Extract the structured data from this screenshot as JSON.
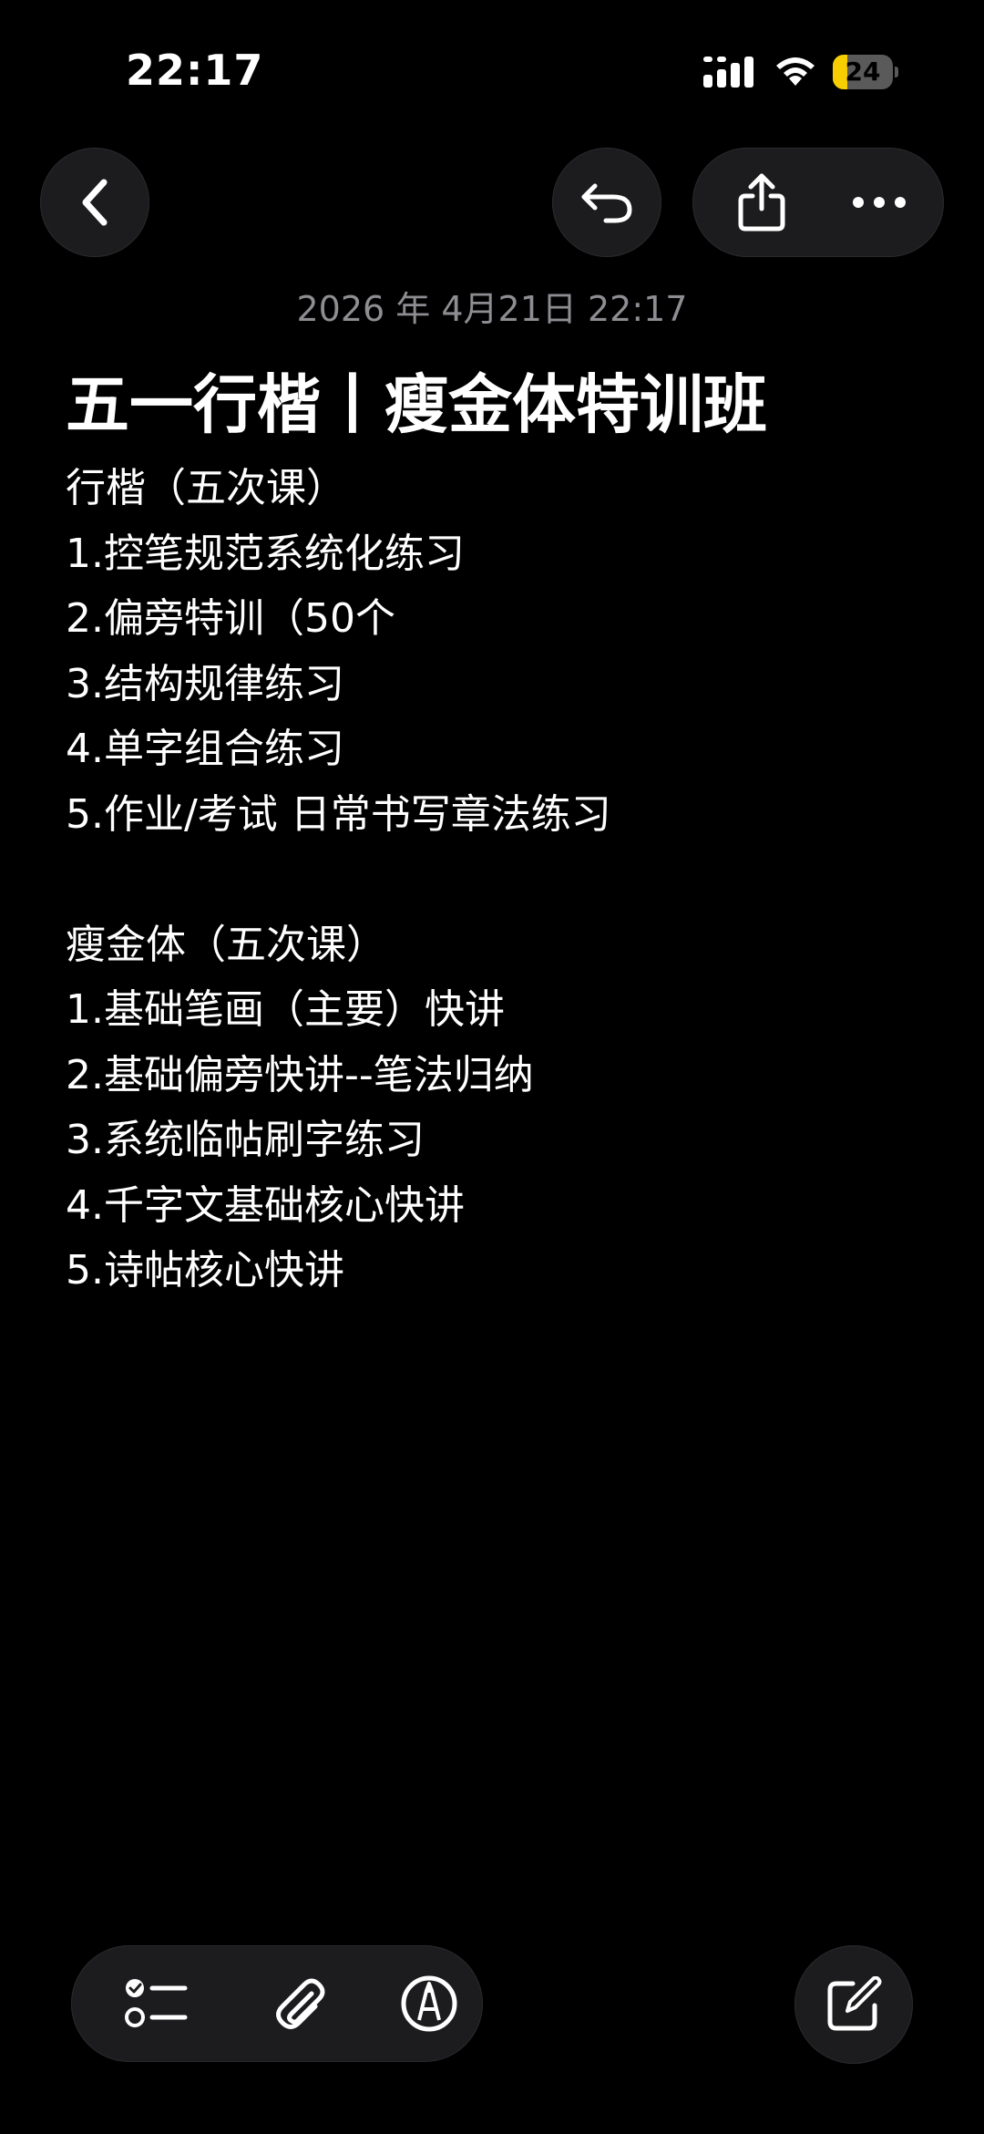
{
  "status_bar": {
    "time": "22:17",
    "battery_level": "24",
    "battery_fraction": 0.24,
    "battery_color": "#f7ce00"
  },
  "nav": {
    "back_icon": "chevron-left-icon",
    "undo_icon": "undo-arrow-icon",
    "share_icon": "share-icon",
    "more_icon": "ellipsis-icon"
  },
  "note": {
    "date": "2026 年 4月21日 22:17",
    "title": "五一行楷丨瘦金体特训班",
    "lines": [
      "行楷（五次课）",
      "1.控笔规范系统化练习",
      "2.偏旁特训（50个",
      "3.结构规律练习",
      "4.单字组合练习",
      "5.作业/考试 日常书写章法练习",
      "",
      "瘦金体（五次课）",
      "1.基础笔画（主要）快讲",
      "2.基础偏旁快讲--笔法归纳",
      "3.系统临帖刷字练习",
      "4.千字文基础核心快讲",
      "5.诗帖核心快讲"
    ]
  },
  "toolbar": {
    "checklist_icon": "checklist-icon",
    "attach_icon": "paperclip-icon",
    "markup_icon": "markup-pen-icon",
    "compose_icon": "compose-icon"
  },
  "colors": {
    "background": "#000000",
    "button_fill": "#1c1c1e",
    "date_text": "#8d8d92",
    "body_text": "#ffffff"
  }
}
